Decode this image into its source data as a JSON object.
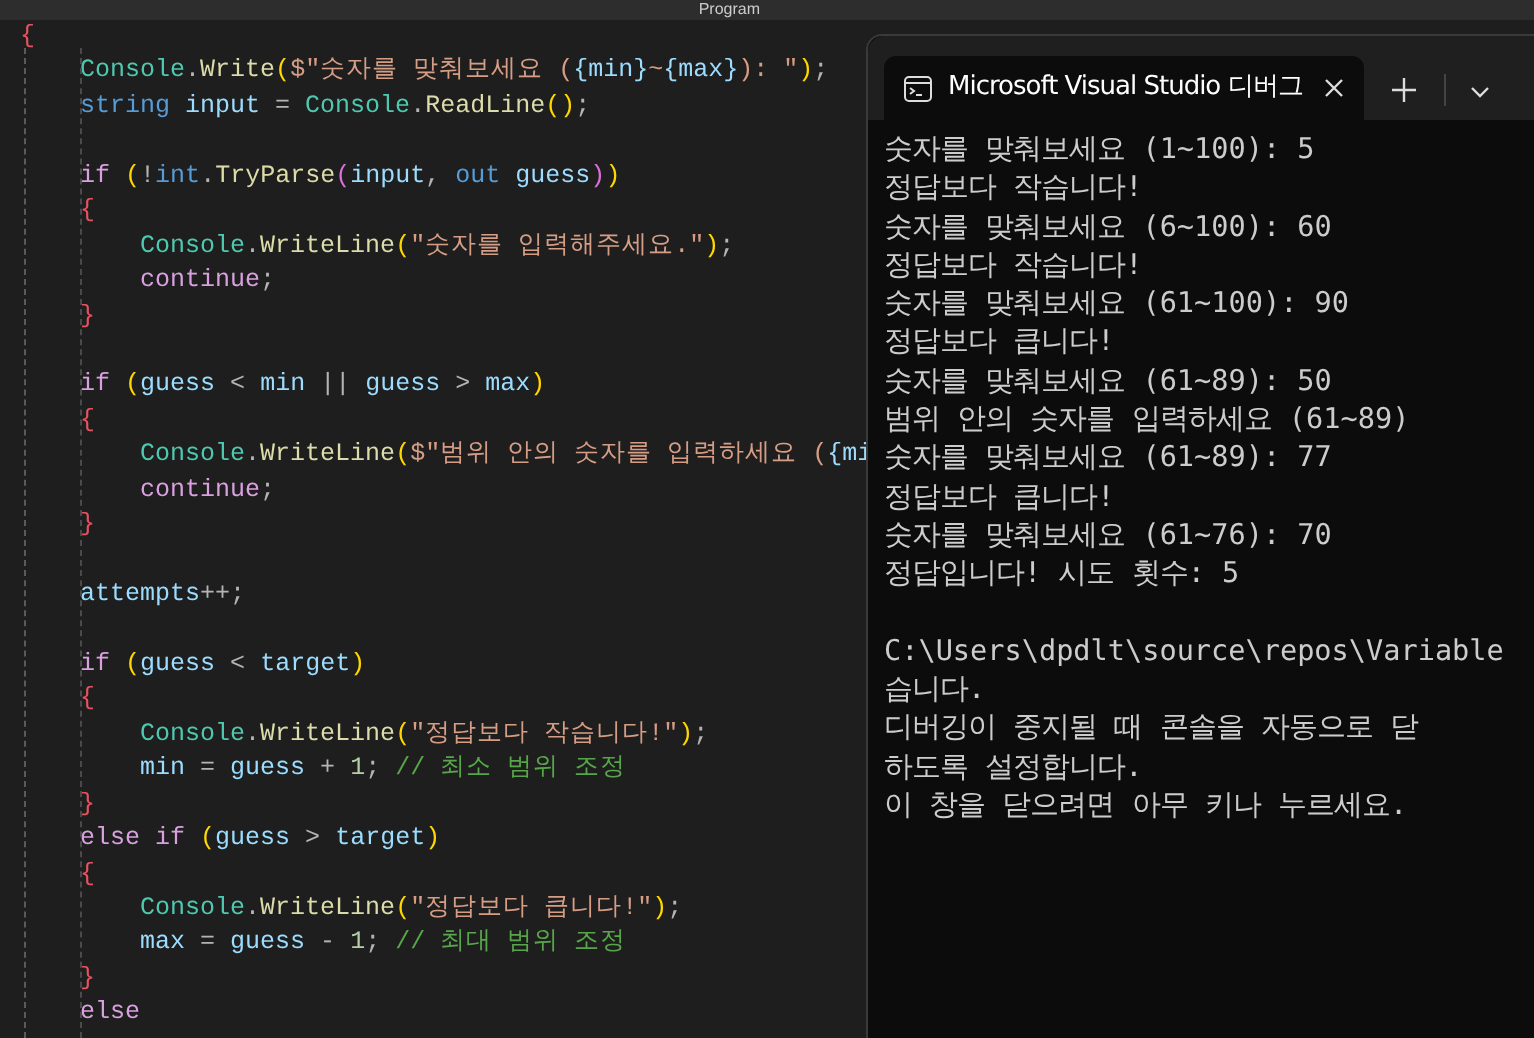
{
  "editor": {
    "tab_label": "Program",
    "lines": [
      {
        "kind": "code",
        "tokens": [
          {
            "kind": "brace",
            "text": "{"
          }
        ]
      },
      {
        "kind": "code",
        "tokens": [
          {
            "kind": "type",
            "text": "    Console"
          },
          {
            "kind": "punct",
            "text": "."
          },
          {
            "kind": "method",
            "text": "Write"
          },
          {
            "kind": "paren",
            "text": "("
          },
          {
            "kind": "string",
            "text": "$\"숫자를 맞춰보세요 ("
          },
          {
            "kind": "variable",
            "text": "{min}"
          },
          {
            "kind": "string",
            "text": "~"
          },
          {
            "kind": "variable",
            "text": "{max}"
          },
          {
            "kind": "string",
            "text": "): \""
          },
          {
            "kind": "paren",
            "text": ")"
          },
          {
            "kind": "punct",
            "text": ";"
          }
        ]
      },
      {
        "kind": "code",
        "tokens": [
          {
            "kind": "keyword",
            "text": "    string "
          },
          {
            "kind": "variable",
            "text": "input"
          },
          {
            "kind": "punct",
            "text": " = "
          },
          {
            "kind": "type",
            "text": "Console"
          },
          {
            "kind": "punct",
            "text": "."
          },
          {
            "kind": "method",
            "text": "ReadLine"
          },
          {
            "kind": "paren",
            "text": "()"
          },
          {
            "kind": "punct",
            "text": ";"
          }
        ]
      },
      {
        "kind": "blank"
      },
      {
        "kind": "code",
        "tokens": [
          {
            "kind": "control",
            "text": "    if "
          },
          {
            "kind": "paren",
            "text": "("
          },
          {
            "kind": "punct",
            "text": "!"
          },
          {
            "kind": "keyword",
            "text": "int"
          },
          {
            "kind": "punct",
            "text": "."
          },
          {
            "kind": "method",
            "text": "TryParse"
          },
          {
            "kind": "paren2",
            "text": "("
          },
          {
            "kind": "variable",
            "text": "input"
          },
          {
            "kind": "punct",
            "text": ", "
          },
          {
            "kind": "keyword",
            "text": "out "
          },
          {
            "kind": "variable",
            "text": "guess"
          },
          {
            "kind": "paren2",
            "text": ")"
          },
          {
            "kind": "paren",
            "text": ")"
          }
        ]
      },
      {
        "kind": "code",
        "tokens": [
          {
            "kind": "brace",
            "text": "    {"
          }
        ]
      },
      {
        "kind": "code",
        "tokens": [
          {
            "kind": "type",
            "text": "        Console"
          },
          {
            "kind": "punct",
            "text": "."
          },
          {
            "kind": "method",
            "text": "WriteLine"
          },
          {
            "kind": "paren",
            "text": "("
          },
          {
            "kind": "string",
            "text": "\"숫자를 입력해주세요.\""
          },
          {
            "kind": "paren",
            "text": ")"
          },
          {
            "kind": "punct",
            "text": ";"
          }
        ]
      },
      {
        "kind": "code",
        "tokens": [
          {
            "kind": "control",
            "text": "        continue"
          },
          {
            "kind": "punct",
            "text": ";"
          }
        ]
      },
      {
        "kind": "code",
        "tokens": [
          {
            "kind": "brace",
            "text": "    }"
          }
        ]
      },
      {
        "kind": "blank"
      },
      {
        "kind": "code",
        "tokens": [
          {
            "kind": "control",
            "text": "    if "
          },
          {
            "kind": "paren",
            "text": "("
          },
          {
            "kind": "variable",
            "text": "guess"
          },
          {
            "kind": "punct",
            "text": " < "
          },
          {
            "kind": "variable",
            "text": "min"
          },
          {
            "kind": "punct",
            "text": " || "
          },
          {
            "kind": "variable",
            "text": "guess"
          },
          {
            "kind": "punct",
            "text": " > "
          },
          {
            "kind": "variable",
            "text": "max"
          },
          {
            "kind": "paren",
            "text": ")"
          }
        ]
      },
      {
        "kind": "code",
        "tokens": [
          {
            "kind": "brace",
            "text": "    {"
          }
        ]
      },
      {
        "kind": "code",
        "tokens": [
          {
            "kind": "type",
            "text": "        Console"
          },
          {
            "kind": "punct",
            "text": "."
          },
          {
            "kind": "method",
            "text": "WriteLine"
          },
          {
            "kind": "paren",
            "text": "("
          },
          {
            "kind": "string",
            "text": "$\"범위 안의 숫자를 입력하세요 ("
          },
          {
            "kind": "variable",
            "text": "{mi"
          }
        ]
      },
      {
        "kind": "code",
        "tokens": [
          {
            "kind": "control",
            "text": "        continue"
          },
          {
            "kind": "punct",
            "text": ";"
          }
        ]
      },
      {
        "kind": "code",
        "tokens": [
          {
            "kind": "brace",
            "text": "    }"
          }
        ]
      },
      {
        "kind": "blank"
      },
      {
        "kind": "code",
        "tokens": [
          {
            "kind": "variable",
            "text": "    attempts"
          },
          {
            "kind": "punct",
            "text": "++;"
          }
        ]
      },
      {
        "kind": "blank"
      },
      {
        "kind": "code",
        "tokens": [
          {
            "kind": "control",
            "text": "    if "
          },
          {
            "kind": "paren",
            "text": "("
          },
          {
            "kind": "variable",
            "text": "guess"
          },
          {
            "kind": "punct",
            "text": " < "
          },
          {
            "kind": "variable",
            "text": "target"
          },
          {
            "kind": "paren",
            "text": ")"
          }
        ]
      },
      {
        "kind": "code",
        "tokens": [
          {
            "kind": "brace",
            "text": "    {"
          }
        ]
      },
      {
        "kind": "code",
        "tokens": [
          {
            "kind": "type",
            "text": "        Console"
          },
          {
            "kind": "punct",
            "text": "."
          },
          {
            "kind": "method",
            "text": "WriteLine"
          },
          {
            "kind": "paren",
            "text": "("
          },
          {
            "kind": "string",
            "text": "\"정답보다 작습니다!\""
          },
          {
            "kind": "paren",
            "text": ")"
          },
          {
            "kind": "punct",
            "text": ";"
          }
        ]
      },
      {
        "kind": "code",
        "tokens": [
          {
            "kind": "variable",
            "text": "        min"
          },
          {
            "kind": "punct",
            "text": " = "
          },
          {
            "kind": "variable",
            "text": "guess"
          },
          {
            "kind": "punct",
            "text": " + "
          },
          {
            "kind": "number",
            "text": "1"
          },
          {
            "kind": "punct",
            "text": "; "
          },
          {
            "kind": "comment",
            "text": "// 최소 범위 조정"
          }
        ]
      },
      {
        "kind": "code",
        "tokens": [
          {
            "kind": "brace",
            "text": "    }"
          }
        ]
      },
      {
        "kind": "code",
        "tokens": [
          {
            "kind": "control",
            "text": "    else if "
          },
          {
            "kind": "paren",
            "text": "("
          },
          {
            "kind": "variable",
            "text": "guess"
          },
          {
            "kind": "punct",
            "text": " > "
          },
          {
            "kind": "variable",
            "text": "target"
          },
          {
            "kind": "paren",
            "text": ")"
          }
        ]
      },
      {
        "kind": "code",
        "tokens": [
          {
            "kind": "brace",
            "text": "    {"
          }
        ]
      },
      {
        "kind": "code",
        "tokens": [
          {
            "kind": "type",
            "text": "        Console"
          },
          {
            "kind": "punct",
            "text": "."
          },
          {
            "kind": "method",
            "text": "WriteLine"
          },
          {
            "kind": "paren",
            "text": "("
          },
          {
            "kind": "string",
            "text": "\"정답보다 큽니다!\""
          },
          {
            "kind": "paren",
            "text": ")"
          },
          {
            "kind": "punct",
            "text": ";"
          }
        ]
      },
      {
        "kind": "code",
        "tokens": [
          {
            "kind": "variable",
            "text": "        max"
          },
          {
            "kind": "punct",
            "text": " = "
          },
          {
            "kind": "variable",
            "text": "guess"
          },
          {
            "kind": "punct",
            "text": " - "
          },
          {
            "kind": "number",
            "text": "1"
          },
          {
            "kind": "punct",
            "text": "; "
          },
          {
            "kind": "comment",
            "text": "// 최대 범위 조정"
          }
        ]
      },
      {
        "kind": "code",
        "tokens": [
          {
            "kind": "brace",
            "text": "    }"
          }
        ]
      },
      {
        "kind": "code",
        "tokens": [
          {
            "kind": "control",
            "text": "    else"
          }
        ]
      }
    ]
  },
  "terminal": {
    "tab_title": "Microsoft Visual Studio 디버그",
    "lines": [
      {
        "kind": "text",
        "text": "숫자를 맞춰보세요 (1~100): 5"
      },
      {
        "kind": "text",
        "text": "정답보다 작습니다!"
      },
      {
        "kind": "text",
        "text": "숫자를 맞춰보세요 (6~100): 60"
      },
      {
        "kind": "text",
        "text": "정답보다 작습니다!"
      },
      {
        "kind": "text",
        "text": "숫자를 맞춰보세요 (61~100): 90"
      },
      {
        "kind": "text",
        "text": "정답보다 큽니다!"
      },
      {
        "kind": "text",
        "text": "숫자를 맞춰보세요 (61~89): 50"
      },
      {
        "kind": "text",
        "text": "범위 안의 숫자를 입력하세요 (61~89)"
      },
      {
        "kind": "text",
        "text": "숫자를 맞춰보세요 (61~89): 77"
      },
      {
        "kind": "text",
        "text": "정답보다 큽니다!"
      },
      {
        "kind": "text",
        "text": "숫자를 맞춰보세요 (61~76): 70"
      },
      {
        "kind": "text",
        "text": "정답입니다! 시도 횟수: 5"
      },
      {
        "kind": "blank"
      },
      {
        "kind": "text",
        "text": "C:\\Users\\dpdlt\\source\\repos\\Variable"
      },
      {
        "kind": "text",
        "text": "습니다."
      },
      {
        "kind": "text",
        "text": "디버깅이 중지될 때 콘솔을 자동으로 닫"
      },
      {
        "kind": "text",
        "text": "하도록 설정합니다."
      },
      {
        "kind": "text",
        "text": "이 창을 닫으려면 아무 키나 누르세요."
      }
    ]
  }
}
